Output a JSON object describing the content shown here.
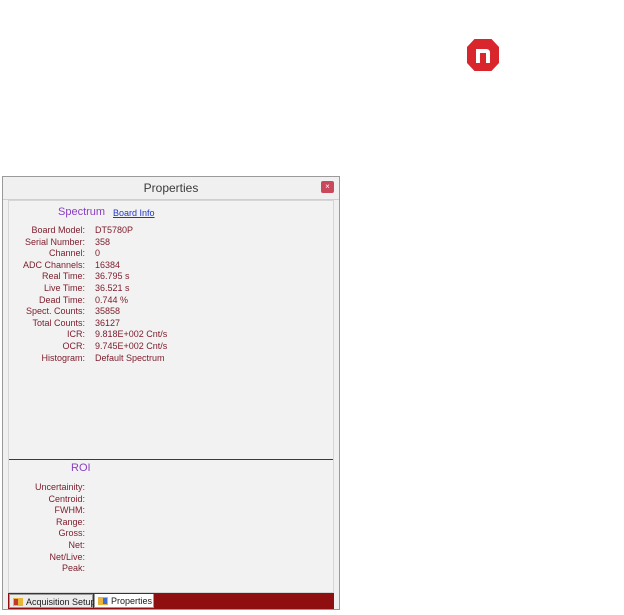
{
  "window": {
    "title": "Properties",
    "close_glyph": "×"
  },
  "spectrum": {
    "title": "Spectrum",
    "board_info_link": "Board Info",
    "rows": [
      {
        "label": "Board Model:",
        "value": "DT5780P"
      },
      {
        "label": "Serial Number:",
        "value": "358"
      },
      {
        "label": "Channel:",
        "value": "0"
      },
      {
        "label": "ADC Channels:",
        "value": "16384"
      },
      {
        "label": "Real Time:",
        "value": "36.795 s"
      },
      {
        "label": "Live Time:",
        "value": "36.521 s"
      },
      {
        "label": "Dead Time:",
        "value": "0.744 %"
      },
      {
        "label": "Spect. Counts:",
        "value": "35858"
      },
      {
        "label": "Total Counts:",
        "value": "36127"
      },
      {
        "label": "ICR:",
        "value": "9.818E+002 Cnt/s"
      },
      {
        "label": "OCR:",
        "value": "9.745E+002 Cnt/s"
      },
      {
        "label": "Histogram:",
        "value": "Default Spectrum"
      }
    ]
  },
  "roi": {
    "title": "ROI",
    "rows": [
      {
        "label": "Uncertainity:",
        "value": ""
      },
      {
        "label": "Centroid:",
        "value": ""
      },
      {
        "label": "FWHM:",
        "value": ""
      },
      {
        "label": "Range:",
        "value": ""
      },
      {
        "label": "Gross:",
        "value": ""
      },
      {
        "label": "Net:",
        "value": ""
      },
      {
        "label": "Net/Live:",
        "value": ""
      },
      {
        "label": "Peak:",
        "value": ""
      }
    ]
  },
  "tabs": [
    {
      "label": "Acquisition Setup",
      "icon": "settings-panel-icon"
    },
    {
      "label": "Properties",
      "icon": "properties-panel-icon"
    }
  ],
  "colors": {
    "accent": "#8a3fc2",
    "label": "#7d1b2a",
    "statusbar": "#8f0f10",
    "logo": "#d8262c"
  }
}
